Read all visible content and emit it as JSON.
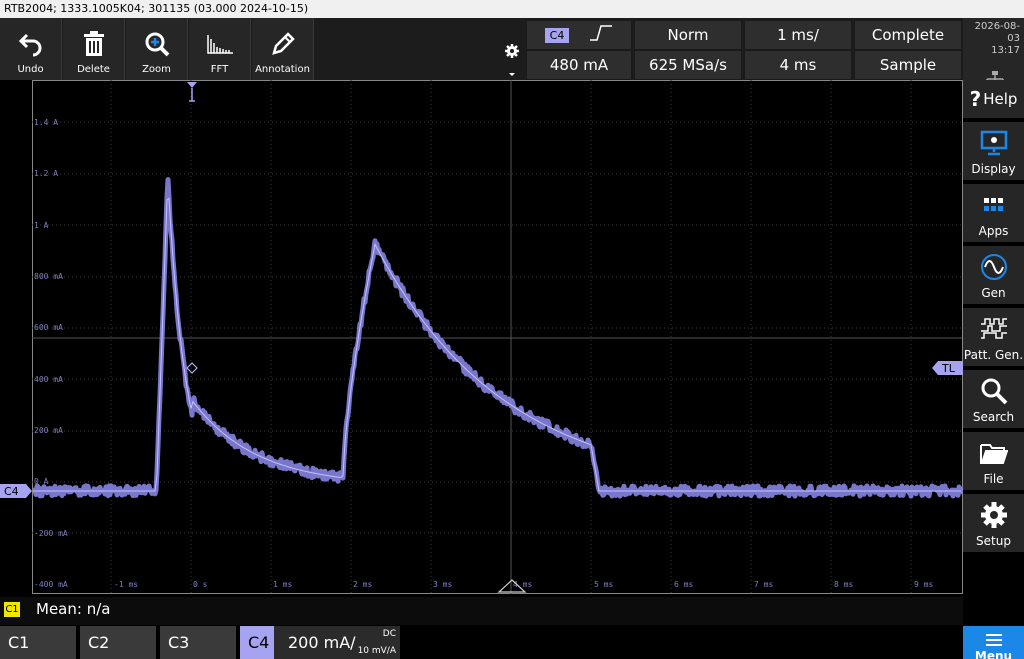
{
  "title": "RTB2004; 1333.1005K04; 301135 (03.000 2024-10-15)",
  "toolbar": [
    {
      "label": "Undo",
      "icon": "undo-icon"
    },
    {
      "label": "Delete",
      "icon": "trash-icon"
    },
    {
      "label": "Zoom",
      "icon": "zoom-icon"
    },
    {
      "label": "FFT",
      "icon": "fft-icon"
    },
    {
      "label": "Annotation",
      "icon": "pencil-icon"
    }
  ],
  "status": {
    "channel": "C4",
    "trigger_level": "480 mA",
    "trigger_mode": "Norm",
    "sample_rate": "625 MSa/s",
    "timebase": "1 ms/",
    "record_length": "4 ms",
    "acq_state": "Complete",
    "acq_mode": "Sample"
  },
  "datetime": {
    "date": "2026-08-03",
    "time": "13:17"
  },
  "sidebar": [
    {
      "label": "Help",
      "icon": "help-icon"
    },
    {
      "label": "Display",
      "icon": "display-icon"
    },
    {
      "label": "Apps",
      "icon": "apps-icon"
    },
    {
      "label": "Gen",
      "icon": "sine-wave-icon"
    },
    {
      "label": "Patt. Gen.",
      "icon": "pattern-icon"
    },
    {
      "label": "Search",
      "icon": "search-icon"
    },
    {
      "label": "File",
      "icon": "folder-icon"
    },
    {
      "label": "Setup",
      "icon": "gear-icon"
    }
  ],
  "y_labels": [
    "1.4 A",
    "1.2 A",
    "1 A",
    "800 mA",
    "600 mA",
    "400 mA",
    "200 mA",
    "0 A",
    "-200 mA",
    "-400 mA"
  ],
  "x_labels": [
    "-1 ms",
    "0 s",
    "1 ms",
    "2 ms",
    "3 ms",
    "4 ms",
    "5 ms",
    "6 ms",
    "7 ms",
    "8 ms",
    "9 ms"
  ],
  "markers": {
    "channel": "C4",
    "trigger_level_marker": "TL"
  },
  "measurement": {
    "badge": "C1",
    "text": "Mean: n/a"
  },
  "channels": {
    "c1": "C1",
    "c2": "C2",
    "c3": "C3",
    "c4": "C4",
    "c4_scale": "200 mA/",
    "c4_coupling": "DC",
    "c4_probe": "10 mV/A"
  },
  "menu_label": "Menu",
  "colors": {
    "trace": "#8e8cf0",
    "marker": "#a6a3f0",
    "accent": "#1b87e6",
    "badge": "#f2e600"
  }
}
